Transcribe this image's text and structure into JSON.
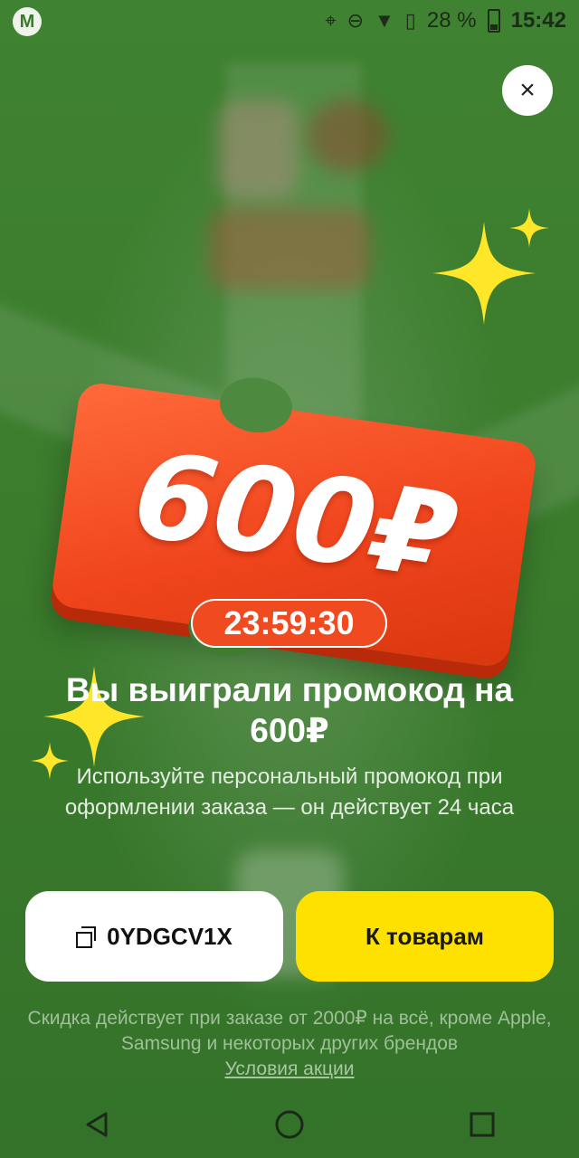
{
  "status_bar": {
    "app_icon": "yandex-market-logo",
    "battery_text": "28 %",
    "time": "15:42"
  },
  "close": {
    "label": "×"
  },
  "ticket": {
    "amount": "600₽",
    "timer": "23:59:30"
  },
  "title": "Вы выиграли промокод на 600₽",
  "description": "Используйте персональный промокод при оформлении заказа — он действует 24 часа",
  "buttons": {
    "promo_code": "0YDGCV1X",
    "to_products": "К товарам"
  },
  "footnote": {
    "text": "Скидка действует при заказе от 2000₽ на всё, кроме Apple, Samsung и некоторых других брендов",
    "link": "Условия акции"
  },
  "colors": {
    "background": "#3b7a2d",
    "ticket": "#f0451d",
    "accent_button": "#ffe100",
    "sparkle": "#ffe629"
  }
}
